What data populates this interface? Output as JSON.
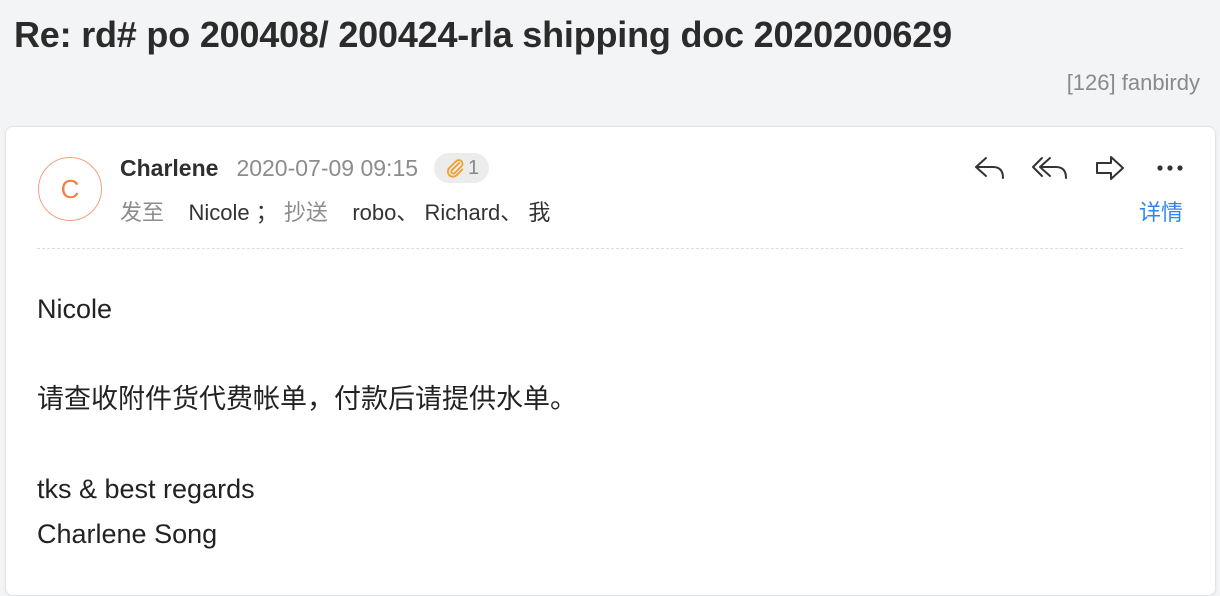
{
  "email": {
    "subject": "Re: rd# po 200408/ 200424-rla shipping doc 2020200629",
    "folder": "[126] fanbirdy",
    "sender": {
      "initial": "C",
      "name": "Charlene",
      "date": "2020-07-09 09:15"
    },
    "attachments": {
      "icon": "paperclip-icon",
      "count": "1"
    },
    "recipients": {
      "to_label": "发至",
      "to": "Nicole",
      "separator": "；",
      "cc_label": "抄送",
      "cc": "robo、 Richard、 我"
    },
    "actions": {
      "reply_icon": "reply-icon",
      "reply_all_icon": "reply-all-icon",
      "forward_icon": "forward-icon",
      "more_icon": "more-icon",
      "details_label": "详情"
    },
    "body": {
      "greeting": "Nicole",
      "line1": "请查收附件货代费帐单，付款后请提供水单。",
      "closing": "tks & best regards",
      "signature": "Charlene Song"
    }
  },
  "colors": {
    "background": "#f3f4f6",
    "avatar_accent": "#f07f4a",
    "link": "#2f86f0",
    "attachment_clip": "#f0a030"
  }
}
